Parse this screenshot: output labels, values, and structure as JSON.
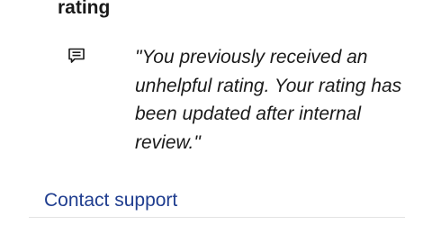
{
  "section": {
    "heading": "rating",
    "icon": "message-icon",
    "quote": "\"You previously received an unhelpful rating. Your rating has been updated after internal review.\""
  },
  "footer": {
    "contact_label": "Contact support",
    "link_color": "#1f3d8f"
  }
}
